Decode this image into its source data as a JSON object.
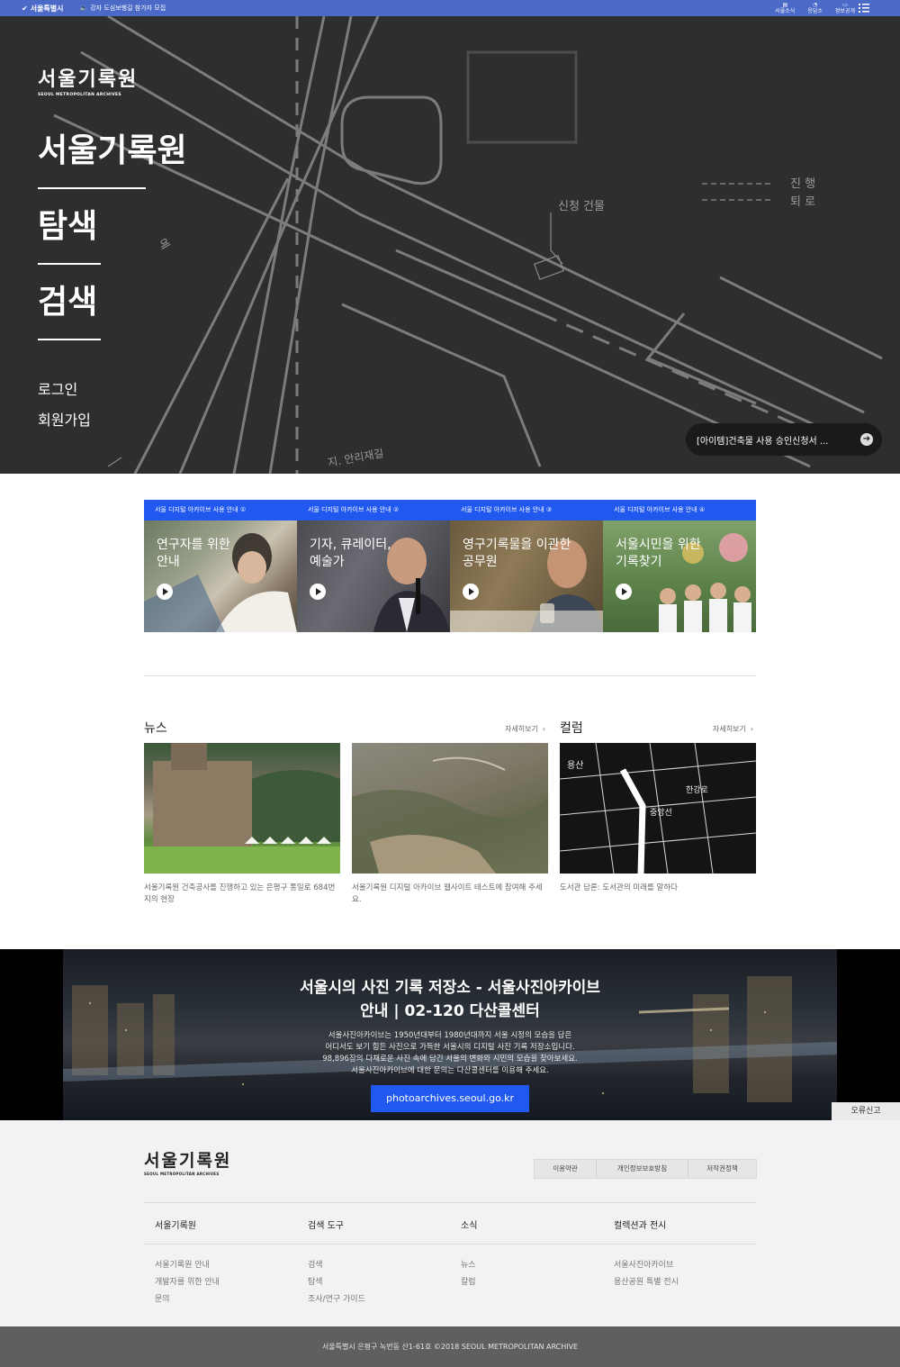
{
  "topbar": {
    "seoul_label": "서울특별시",
    "notice": "강자 도심보행길 참가자 모집",
    "right_items": [
      "서울소식",
      "응답소",
      "정보공개"
    ]
  },
  "hero": {
    "logo_text": "서울기록원",
    "logo_sub": "SEOUL METROPOLITAN ARCHIVES",
    "title": "서울기록원",
    "nav_explore": "탐색",
    "nav_search": "검색",
    "login": "로그인",
    "signup": "회원가입",
    "ticker": "[아이템]건축물 사용 승인신청서 ...",
    "map_labels": [
      "신청 건물",
      "진 행",
      "퇴 로",
      "지. 안리재길",
      "예"
    ]
  },
  "guides": [
    {
      "header": "서울 디지털 아카이브 사용 안내 ①",
      "title": "연구자를 위한\n안내"
    },
    {
      "header": "서울 디지털 아카이브 사용 안내 ②",
      "title": "기자, 큐레이터,\n예술가"
    },
    {
      "header": "서울 디지털 아카이브 사용 안내 ③",
      "title": "영구기록물을 이관한\n공무원"
    },
    {
      "header": "서울 디지털 아카이브 사용 안내 ④",
      "title": "서울시민을 위한\n기록찾기"
    }
  ],
  "news": {
    "title": "뉴스",
    "more": "자세히보기",
    "items": [
      "서울기록원 건축공사를 진행하고 있는 은평구 통일로 684번지의 현장",
      "서울기록원 디지털 아카이브 웹사이트 테스트에 참여해 주세요."
    ]
  },
  "column": {
    "title": "컬럼",
    "more": "자세히보기",
    "items": [
      "도서관 담론: 도서관의 미래를 말하다"
    ]
  },
  "banner": {
    "title_line1": "서울시의 사진 기록 저장소 - 서울사진아카이브",
    "title_line2": "안내 | 02-120 다산콜센터",
    "description": "서울사진아카이브는 1950년대부터 1980년대까지 서울 시정의 모습을 담은\n어디서도 보기 힘든 사진으로 가득한 서울시의 디지털 사진 기록 저장소입니다.\n98,896장의 다채로운 사진 속에 담긴 서울의 변화와 시민의 모습을 찾아보세요.\n서울사진아카이브에 대한 문의는 다산콜센터를 이용해 주세요.",
    "button": "photoarchives.seoul.go.kr",
    "report": "오류신고"
  },
  "footer": {
    "logo_text": "서울기록원",
    "logo_sub": "SEOUL METROPOLITAN ARCHIVES",
    "policies": [
      "이용약관",
      "개인정보보호방침",
      "저작권정책"
    ],
    "columns": [
      {
        "heading": "서울기록원",
        "links": [
          "서울기록원 안내",
          "개발자를 위한 안내",
          "문의"
        ]
      },
      {
        "heading": "검색 도구",
        "links": [
          "검색",
          "탐색",
          "조사/연구 가이드"
        ]
      },
      {
        "heading": "소식",
        "links": [
          "뉴스",
          "칼럼"
        ]
      },
      {
        "heading": "컬렉션과 전시",
        "links": [
          "서울사진아카이브",
          "용산공원 특별 전시"
        ]
      }
    ],
    "copyright": "서울특별시 은평구 녹번동 산1-61호 ©2018 SEOUL METROPOLITAN ARCHIVE"
  },
  "colors": {
    "topbar": "#4b6ac8",
    "accent": "#2058f0",
    "hero_bg": "#2e2e2e",
    "footer_bg": "#f2f2f4",
    "bottom_bg": "#5f5f5f"
  }
}
